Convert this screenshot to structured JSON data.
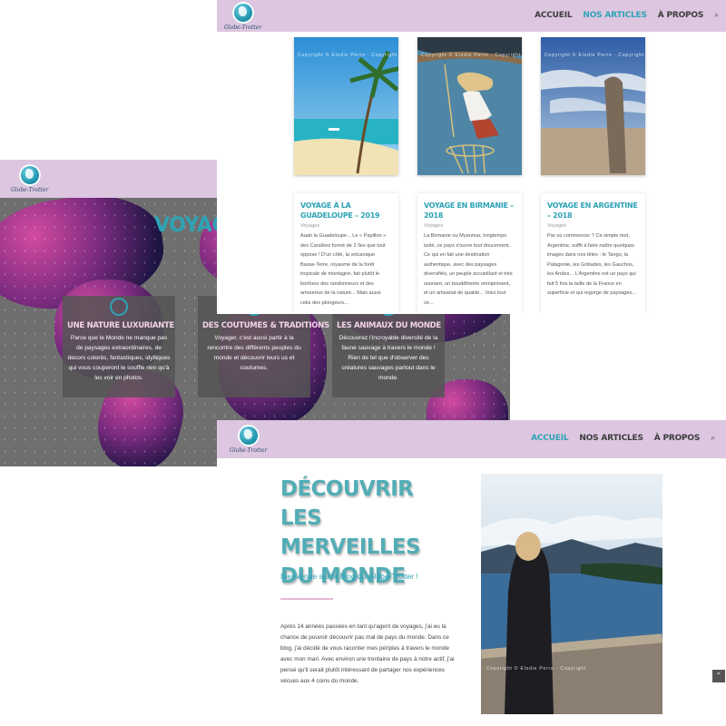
{
  "brand": {
    "logo_text": "Globe-Trotter"
  },
  "colors": {
    "header_bg": "#dcc6e0",
    "accent": "#2ea3b5",
    "title_pink": "#f2d3e8"
  },
  "hero_page": {
    "title": "VOYAGE",
    "features": [
      {
        "icon": "compass-icon",
        "title": "UNE NATURE LUXURIANTE",
        "text": "Parce que le Monde ne manque pas de paysages extraordinaires, de decors colorés, fantastiques, idylliques qui vous couperont le souffle rien qu'à les voir en photos."
      },
      {
        "icon": "people-icon",
        "title": "DES COUTUMES & TRADITIONS",
        "text": "Voyager, c'est aussi partir à la rencontre des différents peuples du monde et découvrir leurs us et coutumes."
      },
      {
        "icon": "paw-icon",
        "title": "LES ANIMAUX DU MONDE",
        "text": "Découvrez l'incroyable diversité de la faune sauvage à travers le monde ! Rien de tel que d'observer des créatures sauvages partout dans le monde."
      }
    ]
  },
  "articles_page": {
    "nav": {
      "home": "ACCUEIL",
      "articles": "NOS ARTICLES",
      "about": "À PROPOS",
      "search": "⌕"
    },
    "thumb_watermark": "Copyright © Elodie Perro · Copyright",
    "articles": [
      {
        "title": "VOYAGE À LA GUADELOUPE – 2019",
        "category": "Voyages",
        "excerpt": "Aaah la Guadeloupe... Le « Papillon » des Caraïbes formé de 2 îles que tout oppose ! D'un côté, la volcanique Basse-Terre, royaume de la forêt tropicale de montagne, fait plutôt le bonheur des randonneurs et des amoureux de la nature... Mais aussi celui des plongeurs..."
      },
      {
        "title": "VOYAGE EN BIRMANIE – 2018",
        "category": "Voyages",
        "excerpt": "La Birmanie ou Myanmar, longtemps isolé, ce pays s'ouvre tout doucement. Ce qui en fait une destination authentique, avec des paysages diversifiés, un peuple accueillant et très souriant, un bouddhisme omniprésent, et un artisanat de qualité... Voici tout ce..."
      },
      {
        "title": "VOYAGE EN ARGENTINE – 2018",
        "category": "Voyages",
        "excerpt": "Par où commencer ? Ce simple mot, Argentine, suffit à faire naître quelques images dans nos têtes : le Tango, la Patagonie, les Gribades, les Gauchos, les Andes... L'Argentine est un pays qui fait 5 fois la taille de la France en superficie et qui regorge de paysages..."
      }
    ]
  },
  "about_page": {
    "nav": {
      "home": "ACCUEIL",
      "articles": "NOS ARTICLES",
      "about": "À PROPOS",
      "search": "⌕"
    },
    "title": "DÉCOUVRIR LES MERVEILLES DU MONDE",
    "subtitle": "Bienvenue sur le Blog du Globe-Trotter !",
    "body": "Après 14 années passées en tant qu'agent de voyages, j'ai eu la chance de pouvoir découvrir pas mal de pays du monde. Dans ce blog, j'ai décidé de vous raconter mes périples à travers le monde avec mon mari. Avec environ une trentaine de pays à notre actif, j'ai pensé qu'il serait plutôt intéressant de partager nos expériences vécues aux 4 coins du monde.",
    "photo_watermark": "Copyright © Elodie Perro · Copyright"
  },
  "scroll_top": "⌃"
}
